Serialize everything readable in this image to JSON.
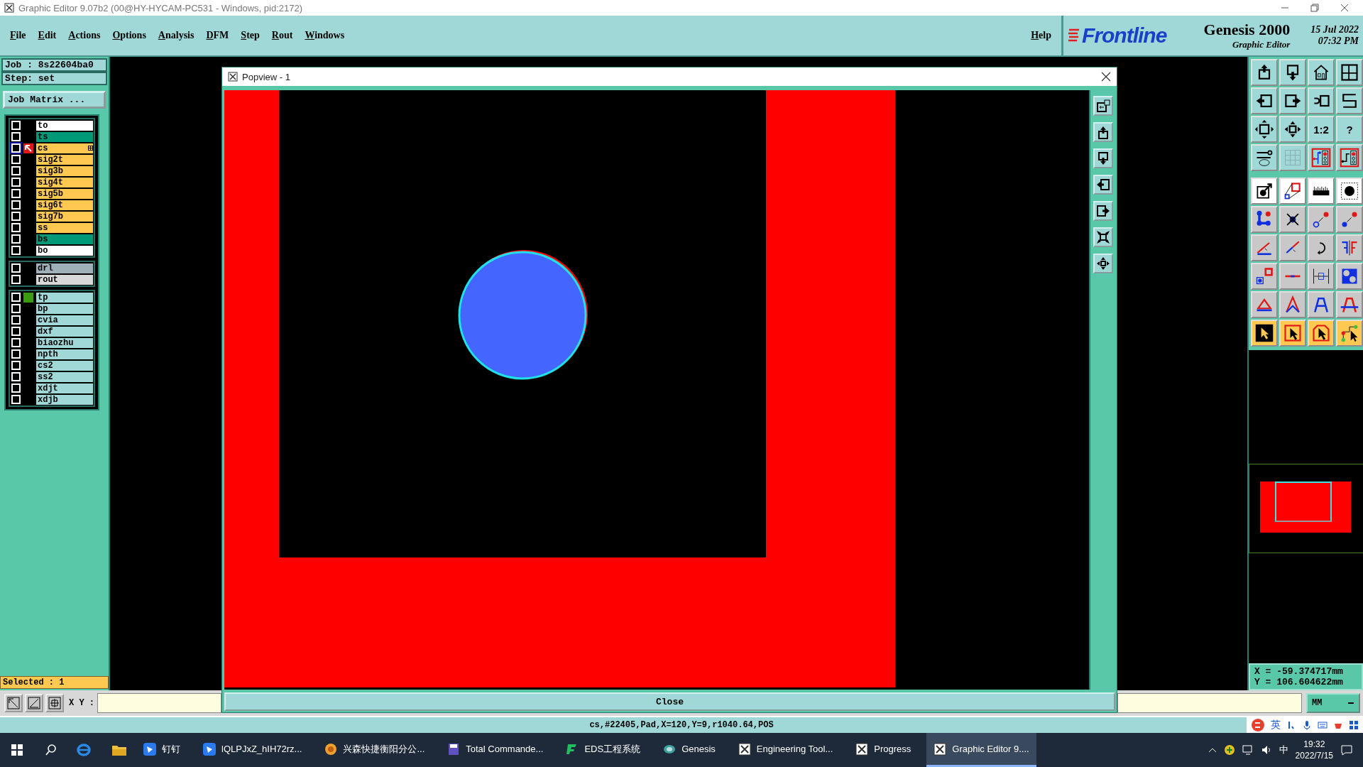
{
  "window": {
    "title": "Graphic Editor 9.07b2 (00@HY-HYCAM-PC531 - Windows, pid:2172)"
  },
  "menu": [
    {
      "label": "File"
    },
    {
      "label": "Edit"
    },
    {
      "label": "Actions"
    },
    {
      "label": "Options"
    },
    {
      "label": "Analysis"
    },
    {
      "label": "DFM"
    },
    {
      "label": "Step"
    },
    {
      "label": "Rout"
    },
    {
      "label": "Windows"
    }
  ],
  "help": "Help",
  "brand": {
    "logo": "Frontline",
    "product": "Genesis 2000",
    "subtitle": "Graphic Editor",
    "date": "15 Jul 2022",
    "time": "07:32 PM"
  },
  "job": {
    "job": "Job : 8s22604ba0",
    "step": "Step: set",
    "matrix_button": "Job Matrix ..."
  },
  "layer_groups": [
    [
      {
        "name": "to",
        "color": "#ffffff",
        "checked": false,
        "work": false,
        "affected": false
      },
      {
        "name": "ts",
        "color": "#009a78",
        "checked": false,
        "work": false,
        "affected": false
      },
      {
        "name": "cs",
        "color": "#ffc850",
        "checked": false,
        "work": true,
        "affected": false
      },
      {
        "name": "sig2t",
        "color": "#ffc850",
        "checked": false,
        "work": false,
        "affected": false
      },
      {
        "name": "sig3b",
        "color": "#ffc850",
        "checked": false,
        "work": false,
        "affected": false
      },
      {
        "name": "sig4t",
        "color": "#ffc850",
        "checked": false,
        "work": false,
        "affected": false
      },
      {
        "name": "sig5b",
        "color": "#ffc850",
        "checked": false,
        "work": false,
        "affected": false
      },
      {
        "name": "sig6t",
        "color": "#ffc850",
        "checked": false,
        "work": false,
        "affected": false
      },
      {
        "name": "sig7b",
        "color": "#ffc850",
        "checked": false,
        "work": false,
        "affected": false
      },
      {
        "name": "ss",
        "color": "#ffc850",
        "checked": false,
        "work": false,
        "affected": false
      },
      {
        "name": "bs",
        "color": "#009a78",
        "checked": false,
        "work": false,
        "affected": false
      },
      {
        "name": "bo",
        "color": "#ffffff",
        "checked": false,
        "work": false,
        "affected": false
      }
    ],
    [
      {
        "name": "drl",
        "color": "#a0b0b8",
        "checked": false,
        "work": false,
        "affected": false
      },
      {
        "name": "rout",
        "color": "#d8d8d8",
        "checked": false,
        "work": false,
        "affected": false
      }
    ],
    [
      {
        "name": "tp",
        "color": "#a0d8d8",
        "checked": false,
        "work": false,
        "affected": true
      },
      {
        "name": "bp",
        "color": "#a0d8d8",
        "checked": false,
        "work": false,
        "affected": false
      },
      {
        "name": "cvia",
        "color": "#a0d8d8",
        "checked": false,
        "work": false,
        "affected": false
      },
      {
        "name": "dxf",
        "color": "#a0d8d8",
        "checked": false,
        "work": false,
        "affected": false
      },
      {
        "name": "biaozhu",
        "color": "#a0d8d8",
        "checked": false,
        "work": false,
        "affected": false
      },
      {
        "name": "npth",
        "color": "#a0d8d8",
        "checked": false,
        "work": false,
        "affected": false
      },
      {
        "name": "cs2",
        "color": "#a0d8d8",
        "checked": false,
        "work": false,
        "affected": false
      },
      {
        "name": "ss2",
        "color": "#a0d8d8",
        "checked": false,
        "work": false,
        "affected": false
      },
      {
        "name": "xdjt",
        "color": "#a0d8d8",
        "checked": false,
        "work": false,
        "affected": false
      },
      {
        "name": "xdjb",
        "color": "#a0d8d8",
        "checked": false,
        "work": false,
        "affected": false
      }
    ]
  ],
  "selected_count": "Selected : 1",
  "toolbar_texts": [
    "1:2",
    "?"
  ],
  "coordinates": {
    "x": "X = -59.374717mm",
    "y": "Y = 106.604622mm"
  },
  "popview": {
    "title": "Popview - 1",
    "close_button": "Close"
  },
  "command": {
    "label": "X Y :",
    "units": "MM"
  },
  "status": "cs,#22405,Pad,X=120,Y=9,r1040.64,POS",
  "ime": {
    "language": "英"
  },
  "taskbar": {
    "apps": [
      {
        "label": "钉钉",
        "active": false
      },
      {
        "label": "lQLPJxZ_hIH72rz...",
        "active": false
      },
      {
        "label": "兴森快捷衡阳分公...",
        "active": false
      },
      {
        "label": "Total Commande...",
        "active": false
      },
      {
        "label": "EDS工程系统",
        "active": false
      },
      {
        "label": "Genesis",
        "active": false
      },
      {
        "label": "Engineering Tool...",
        "active": false
      },
      {
        "label": "Progress",
        "active": false
      },
      {
        "label": "Graphic Editor 9....",
        "active": true
      }
    ],
    "language": "中",
    "time": "19:32",
    "date": "2022/7/15"
  }
}
